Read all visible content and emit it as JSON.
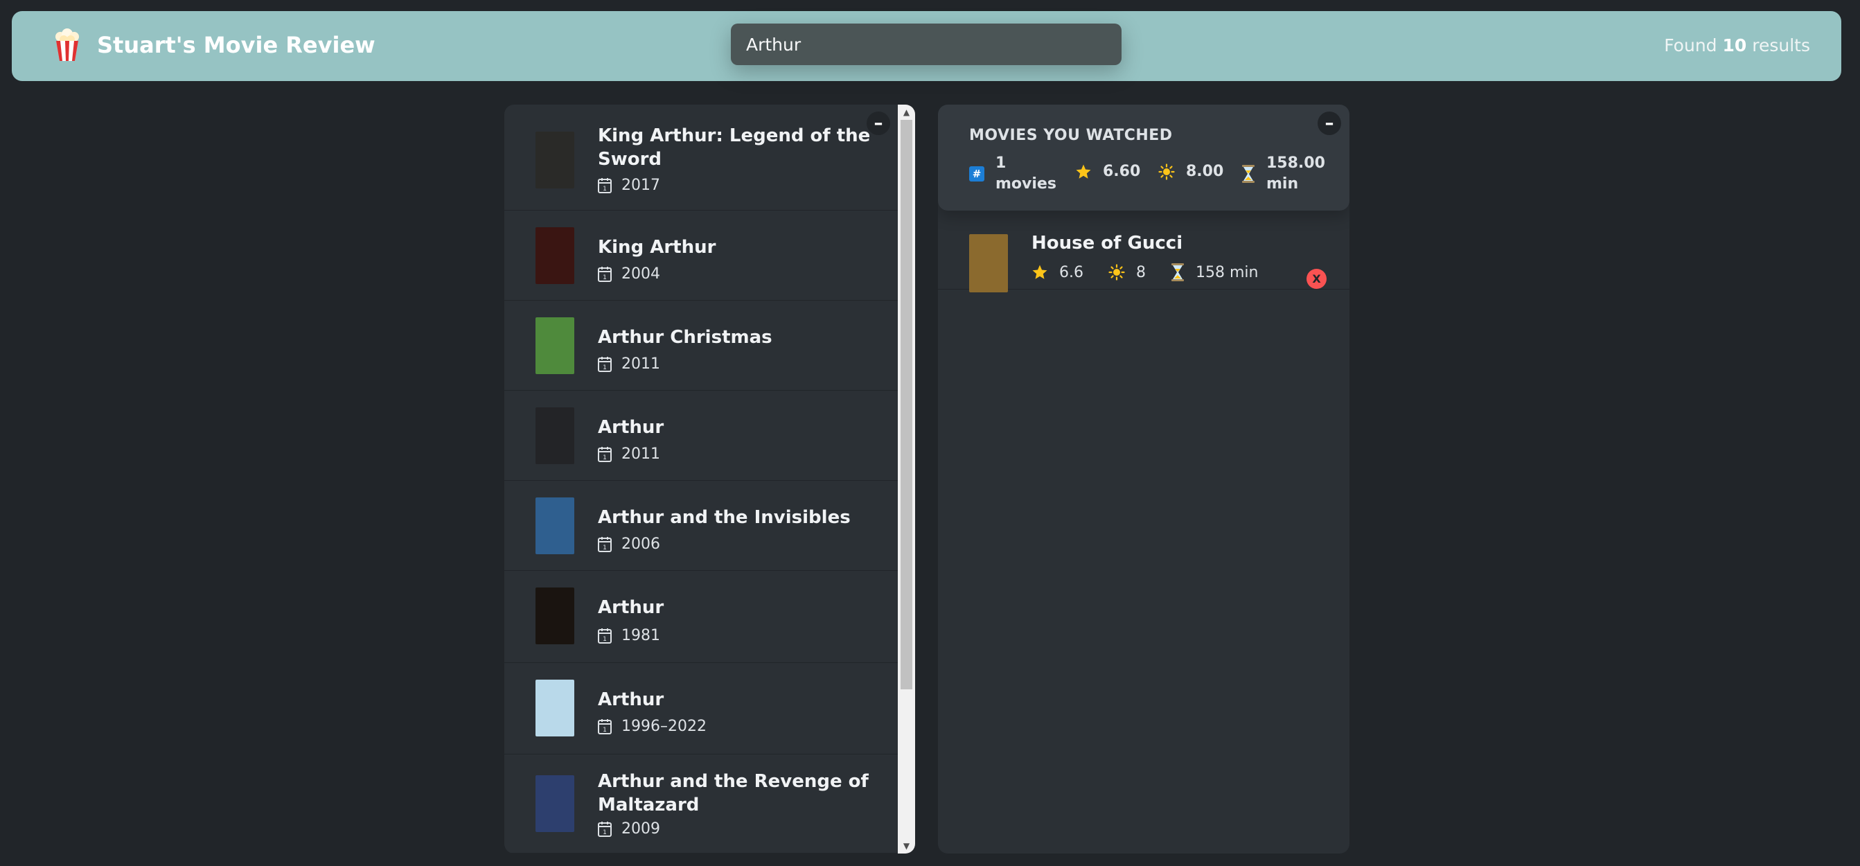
{
  "nav": {
    "logo_icon": "popcorn-icon",
    "title": "Stuart's Movie Review",
    "search_value": "Arthur",
    "found_prefix": "Found",
    "found_count": "10",
    "found_suffix": "results"
  },
  "movies": [
    {
      "title": "King Arthur: Legend of the Sword",
      "year": "2017",
      "poster_color": "#2a2a28"
    },
    {
      "title": "King Arthur",
      "year": "2004",
      "poster_color": "#3a1512"
    },
    {
      "title": "Arthur Christmas",
      "year": "2011",
      "poster_color": "#4f8a3c"
    },
    {
      "title": "Arthur",
      "year": "2011",
      "poster_color": "#232427"
    },
    {
      "title": "Arthur and the Invisibles",
      "year": "2006",
      "poster_color": "#2f5f8f"
    },
    {
      "title": "Arthur",
      "year": "1981",
      "poster_color": "#1a1410"
    },
    {
      "title": "Arthur",
      "year": "1996–2022",
      "poster_color": "#b9d9ea"
    },
    {
      "title": "Arthur and the Revenge of Maltazard",
      "year": "2009",
      "poster_color": "#2d3f6e"
    }
  ],
  "summary": {
    "heading": "MOVIES YOU WATCHED",
    "count_value": "1",
    "count_unit": "movies",
    "avg_imdb": "6.60",
    "avg_user": "8.00",
    "avg_runtime": "158.00",
    "runtime_unit": "min"
  },
  "watched": [
    {
      "title": "House of Gucci",
      "imdb": "6.6",
      "user": "8",
      "runtime": "158 min",
      "poster_color": "#8b6a2e",
      "delete_label": "X"
    }
  ],
  "toggle_label": "–",
  "colors": {
    "accent": "#96c3c3",
    "background": "#212529",
    "panel": "#2b3035",
    "summary": "#343a40",
    "delete": "#fa5252"
  }
}
